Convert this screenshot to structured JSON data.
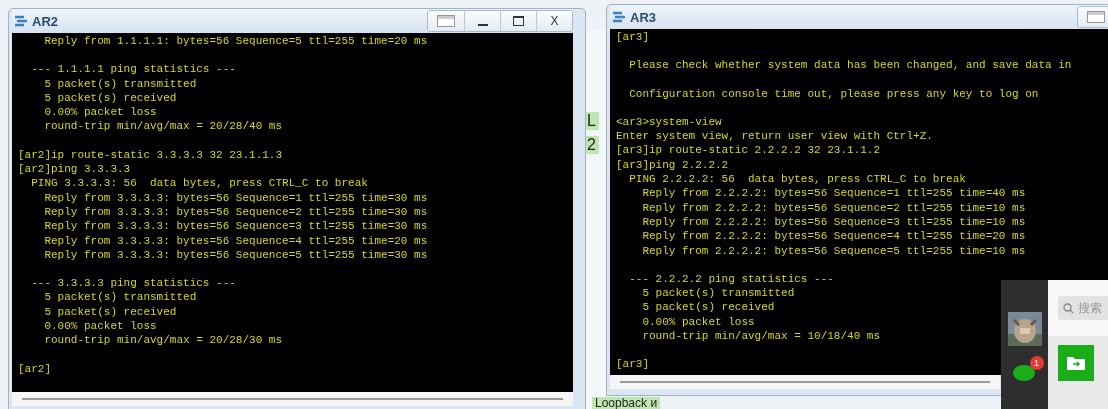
{
  "windows": [
    {
      "title": "AR2",
      "controls": [
        {
          "kind": "layout"
        },
        {
          "kind": "minimize"
        },
        {
          "kind": "maximize"
        },
        {
          "kind": "close",
          "label": "X"
        }
      ],
      "blocks": [
        [
          "    Reply from 1.1.1.1: bytes=56 Sequence=5 ttl=255 time=20 ms"
        ],
        [
          "  --- 1.1.1.1 ping statistics ---",
          "    5 packet(s) transmitted",
          "    5 packet(s) received",
          "    0.00% packet loss",
          "    round-trip min/avg/max = 20/28/40 ms"
        ],
        [
          "[ar2]ip route-static 3.3.3.3 32 23.1.1.3",
          "[ar2]ping 3.3.3.3",
          "  PING 3.3.3.3: 56  data bytes, press CTRL_C to break",
          "    Reply from 3.3.3.3: bytes=56 Sequence=1 ttl=255 time=30 ms",
          "    Reply from 3.3.3.3: bytes=56 Sequence=2 ttl=255 time=30 ms",
          "    Reply from 3.3.3.3: bytes=56 Sequence=3 ttl=255 time=30 ms",
          "    Reply from 3.3.3.3: bytes=56 Sequence=4 ttl=255 time=20 ms",
          "    Reply from 3.3.3.3: bytes=56 Sequence=5 ttl=255 time=30 ms"
        ],
        [
          "  --- 3.3.3.3 ping statistics ---",
          "    5 packet(s) transmitted",
          "    5 packet(s) received",
          "    0.00% packet loss",
          "    round-trip min/avg/max = 20/28/30 ms"
        ],
        [
          "[ar2]"
        ]
      ]
    },
    {
      "title": "AR3",
      "controls": [
        {
          "kind": "layout"
        }
      ],
      "blocks": [
        [
          "[ar3]"
        ],
        [
          "  Please check whether system data has been changed, and save data in"
        ],
        [
          "  Configuration console time out, please press any key to log on"
        ],
        [
          "<ar3>system-view",
          "Enter system view, return user view with Ctrl+Z.",
          "[ar3]ip route-static 2.2.2.2 32 23.1.1.2",
          "[ar3]ping 2.2.2.2",
          "  PING 2.2.2.2: 56  data bytes, press CTRL_C to break",
          "    Reply from 2.2.2.2: bytes=56 Sequence=1 ttl=255 time=40 ms",
          "    Reply from 2.2.2.2: bytes=56 Sequence=2 ttl=255 time=10 ms",
          "    Reply from 2.2.2.2: bytes=56 Sequence=3 ttl=255 time=10 ms",
          "    Reply from 2.2.2.2: bytes=56 Sequence=4 ttl=255 time=20 ms",
          "    Reply from 2.2.2.2: bytes=56 Sequence=5 ttl=255 time=10 ms"
        ],
        [
          "  --- 2.2.2.2 ping statistics ---",
          "    5 packet(s) transmitted",
          "    5 packet(s) received",
          "    0.00% packet loss",
          "    round-trip min/avg/max = 10/18/40 ms"
        ],
        [
          "[ar3]"
        ]
      ]
    }
  ],
  "background_labels": [
    "L",
    "2"
  ],
  "background_footer": "Loopback и",
  "side_panel": {
    "badge": "1",
    "search": {
      "placeholder": "搜索"
    }
  }
}
